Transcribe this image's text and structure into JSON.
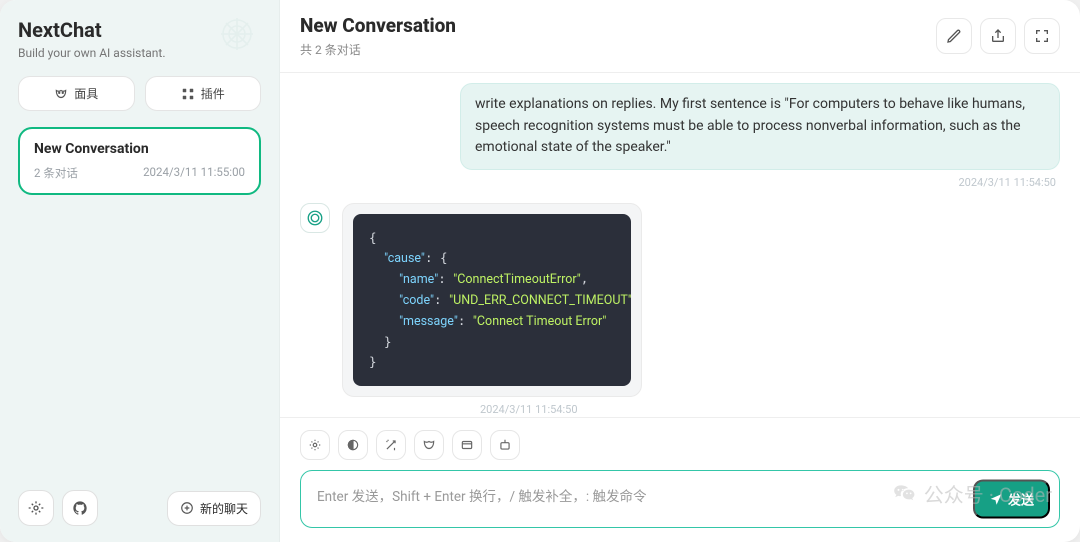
{
  "brand": {
    "title": "NextChat",
    "subtitle": "Build your own AI assistant."
  },
  "sidebarTop": {
    "masks": "面具",
    "plugins": "插件"
  },
  "conversation": {
    "title": "New Conversation",
    "count": "2 条对话",
    "ts": "2024/3/11 11:55:00"
  },
  "sidebarBottom": {
    "newChat": "新的聊天"
  },
  "header": {
    "title": "New Conversation",
    "subtitle": "共 2 条对话"
  },
  "chat": {
    "userMessage": "write explanations on replies. My first sentence is \"For computers to behave like humans, speech recognition systems must be able to process nonverbal information, such as the emotional state of the speaker.\"",
    "userTs": "2024/3/11 11:54:50",
    "error": {
      "cause_name_key": "\"name\"",
      "cause_name_val": "\"ConnectTimeoutError\"",
      "cause_code_key": "\"code\"",
      "cause_code_val": "\"UND_ERR_CONNECT_TIMEOUT\"",
      "cause_msg_key": "\"message\"",
      "cause_msg_val": "\"Connect Timeout Error\""
    },
    "botTs": "2024/3/11 11:54:50"
  },
  "input": {
    "placeholder": "Enter 发送，Shift + Enter 换行，/ 触发补全，: 触发命令",
    "send": "发送"
  },
  "watermark": "公众号 · Coder"
}
